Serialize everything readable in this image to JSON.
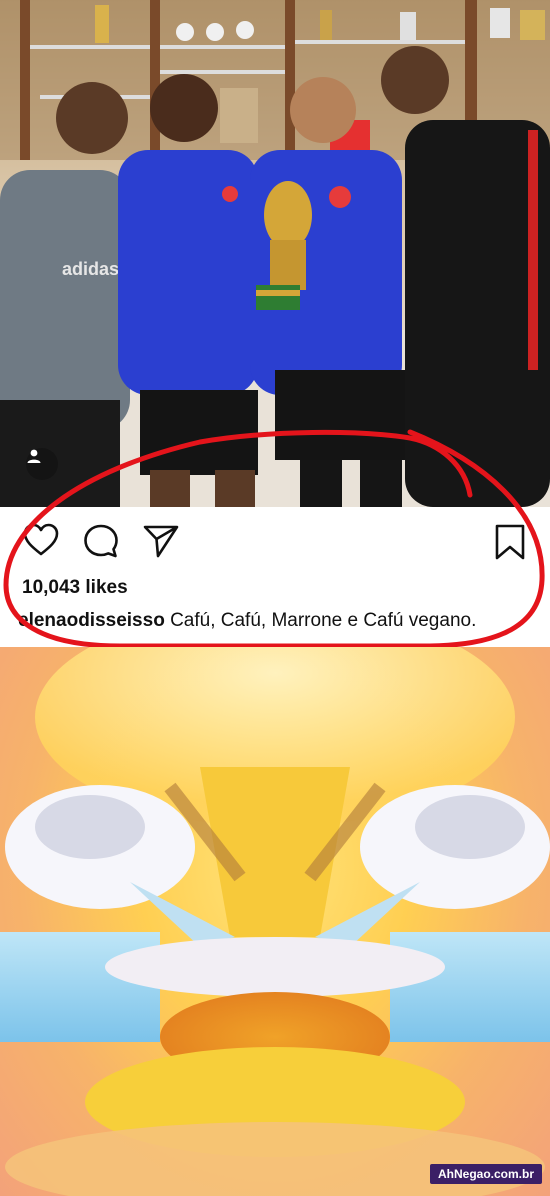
{
  "post": {
    "likes": "10,043 likes",
    "username": "elenaodisseisso",
    "caption": " Cafú, Cafú, Marrone e Cafú vegano."
  },
  "icons": {
    "like": "heart-icon",
    "comment": "comment-icon",
    "share": "share-icon",
    "save": "bookmark-icon",
    "user_tag": "user-icon"
  },
  "colors": {
    "annotation": "#e4141b",
    "jersey": "#2b3fd0",
    "watermark_bg": "#3b1f66"
  },
  "watermark": {
    "text": "AhNegao.com.br"
  }
}
